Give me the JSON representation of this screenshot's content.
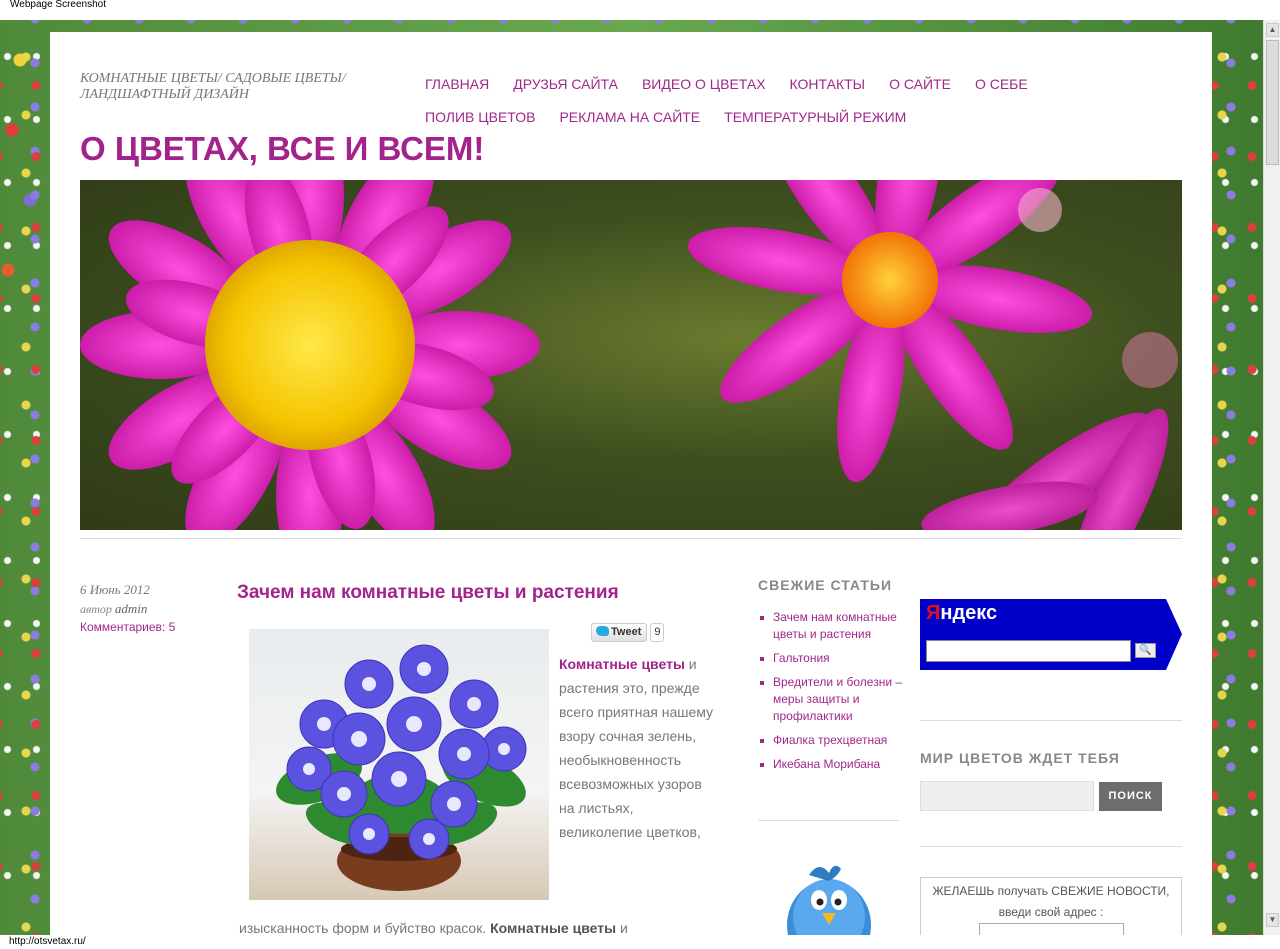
{
  "browser": {
    "window_title": "Webpage Screenshot",
    "status_url": "http://otsvetax.ru/"
  },
  "header": {
    "description": "КОМНАТНЫЕ ЦВЕТЫ/ САДОВЫЕ ЦВЕТЫ/ ЛАНДШАФТНЫЙ ДИЗАЙН",
    "site_title": "О ЦВЕТАХ, ВСЕ И ВСЕМ!",
    "nav": [
      "ГЛАВНАЯ",
      "ДРУЗЬЯ САЙТА",
      "ВИДЕО О ЦВЕТАХ",
      "КОНТАКТЫ",
      "О САЙТЕ",
      "О СЕБЕ",
      "ПОЛИВ ЦВЕТОВ",
      "РЕКЛАМА НА САЙТЕ",
      "ТЕМПЕРАТУРНЫЙ РЕЖИМ"
    ]
  },
  "post": {
    "date": "6 Июнь 2012",
    "author_prefix": "автор",
    "author": "admin",
    "comments": "Комментариев: 5",
    "title": "Зачем нам комнатные цветы и растения",
    "tweet_label": "Tweet",
    "tweet_count": "9",
    "lead_bold": "Комнатные цветы",
    "lead_text": "и растения это, прежде всего приятная нашему взору сочная зелень, необыкновенность всевозможных узоров на листьях, великолепие цветков,",
    "line2_text": "изысканность форм и буйство красок.",
    "line2_bold": "Комнатные цветы",
    "line2_tail": "и"
  },
  "sidebar": {
    "recent_title": "СВЕЖИЕ СТАТЬИ",
    "recent_items": [
      "Зачем нам комнатные цветы и растения",
      "Гальтония",
      "Вредители и болезни – меры защиты и профилактики",
      "Фиалка трехцветная",
      "Икебана Морибана"
    ],
    "yandex_logo_first": "Я",
    "yandex_logo_rest": "ндекс",
    "world_title": "МИР ЦВЕТОВ ЖДЕТ ТЕБЯ",
    "search_button": "ПОИСК",
    "subscribe_line1": "ЖЕЛАЕШЬ получать СВЕЖИЕ НОВОСТИ,",
    "subscribe_line2": "введи свой адрес :"
  },
  "colors": {
    "accent": "#a3238c",
    "link": "#a0288a",
    "yandex_blue": "#0000c8"
  }
}
